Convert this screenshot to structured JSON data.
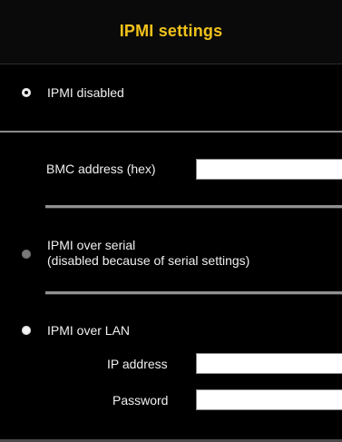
{
  "header": {
    "title": "IPMI settings",
    "title_color": "#f2c21b"
  },
  "options": {
    "disabled": {
      "label": "IPMI disabled",
      "selected": true
    },
    "bmc": {
      "label": "BMC address (hex)",
      "value": ""
    },
    "serial": {
      "label_line1": "IPMI over serial",
      "label_line2": "(disabled because of serial settings)",
      "selected": false,
      "disabled": true
    },
    "lan": {
      "label": "IPMI over LAN",
      "selected": false,
      "ip_label": "IP address",
      "ip_value": "",
      "password_label": "Password",
      "password_value": ""
    }
  }
}
